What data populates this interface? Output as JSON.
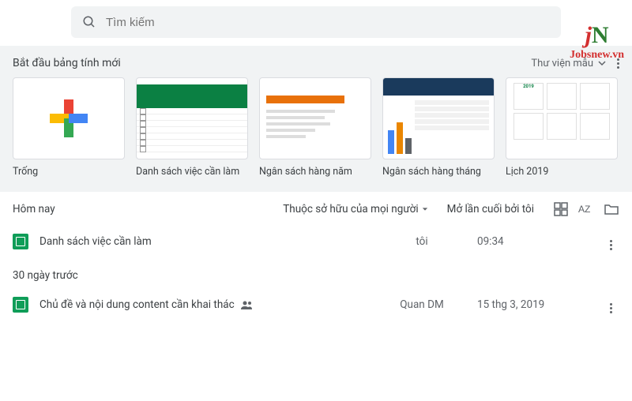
{
  "search": {
    "placeholder": "Tìm kiếm"
  },
  "templates": {
    "header": "Bắt đầu bảng tính mới",
    "gallery": "Thư viện mẫu",
    "items": [
      {
        "label": "Trống"
      },
      {
        "label": "Danh sách việc cần làm"
      },
      {
        "label": "Ngân sách hàng năm"
      },
      {
        "label": "Ngân sách hàng tháng"
      },
      {
        "label": "Lịch 2019"
      }
    ]
  },
  "toolbar": {
    "today": "Hôm nay",
    "owner_filter": "Thuộc sở hữu của mọi người",
    "sort": "Mở lần cuối bởi tôi"
  },
  "groups": [
    {
      "label": "Hôm nay",
      "files": [
        {
          "name": "Danh sách việc cần làm",
          "owner": "tôi",
          "date": "09:34",
          "shared": false
        }
      ]
    },
    {
      "label": "30 ngày trước",
      "files": [
        {
          "name": "Chủ đề và nội dung content cần khai thác",
          "owner": "Quan DM",
          "date": "15 thg 3, 2019",
          "shared": true
        }
      ]
    }
  ],
  "watermark": {
    "logo_j": "j",
    "logo_n": "N",
    "site": "Jobsnew.vn"
  }
}
